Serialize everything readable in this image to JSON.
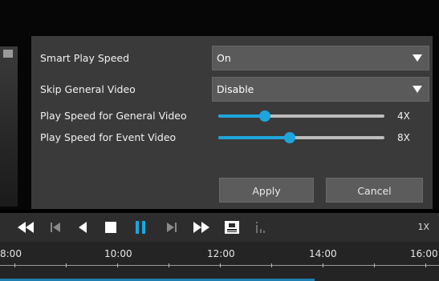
{
  "dialog": {
    "smart_play_speed": {
      "label": "Smart Play Speed",
      "value": "On"
    },
    "skip_general_video": {
      "label": "Skip General Video",
      "value": "Disable"
    },
    "general_speed": {
      "label": "Play Speed for General Video",
      "value": "4X",
      "level": 0.28
    },
    "event_speed": {
      "label": "Play Speed for Event Video",
      "value": "8X",
      "level": 0.43
    },
    "apply_label": "Apply",
    "cancel_label": "Cancel"
  },
  "controls": {
    "speed": "1X",
    "icons": [
      "fast-rewind-icon",
      "step-back-icon",
      "reverse-play-icon",
      "stop-icon",
      "pause-icon",
      "step-forward-icon",
      "fast-forward-icon",
      "snapshot-icon",
      "info-icon"
    ]
  },
  "timeline": {
    "labels": [
      "8:00",
      "10:00",
      "12:00",
      "14:00",
      "16:00"
    ]
  },
  "colors": {
    "accent": "#1ea6dc",
    "panel": "#3a3a3a",
    "control_bar": "#2d2d2d"
  }
}
